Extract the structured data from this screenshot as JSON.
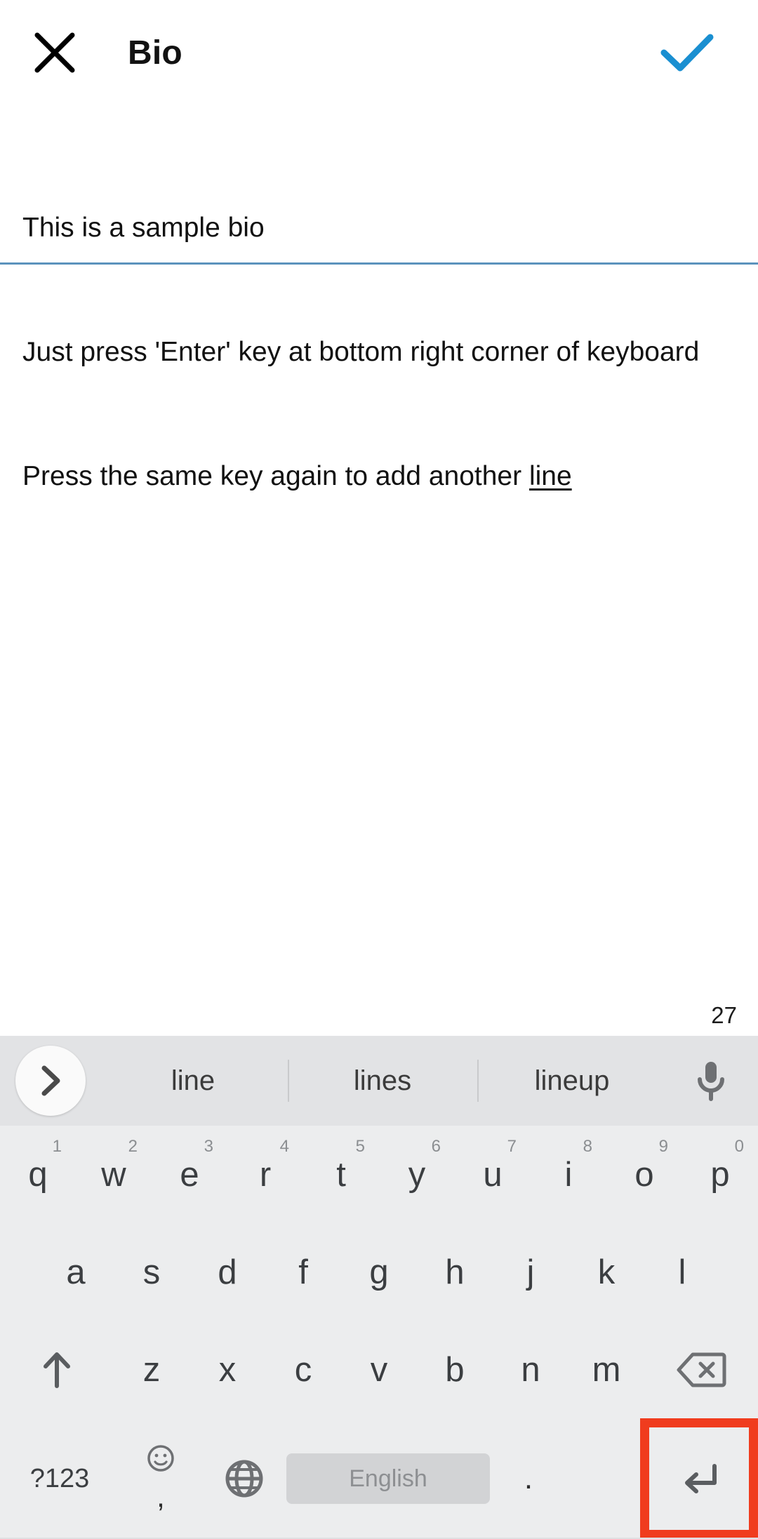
{
  "header": {
    "close_icon": "close-icon",
    "title": "Bio",
    "confirm_icon": "check-icon",
    "accent_color": "#1a8fd1"
  },
  "editor": {
    "lines": [
      "This is a sample bio",
      "Just press 'Enter' key at bottom right corner of keyboard",
      "Press the same key again to add another "
    ],
    "composing_word": "line",
    "char_counter": "27",
    "focus_line_color": "#5b93bd"
  },
  "keyboard": {
    "background": "#ecedee",
    "suggestion_bar": {
      "background": "#e2e3e5",
      "expand_icon": "chevron-right-icon",
      "suggestions": [
        "line",
        "lines",
        "lineup"
      ],
      "mic_icon": "microphone-icon"
    },
    "row1": [
      {
        "letter": "q",
        "num": "1"
      },
      {
        "letter": "w",
        "num": "2"
      },
      {
        "letter": "e",
        "num": "3"
      },
      {
        "letter": "r",
        "num": "4"
      },
      {
        "letter": "t",
        "num": "5"
      },
      {
        "letter": "y",
        "num": "6"
      },
      {
        "letter": "u",
        "num": "7"
      },
      {
        "letter": "i",
        "num": "8"
      },
      {
        "letter": "o",
        "num": "9"
      },
      {
        "letter": "p",
        "num": "0"
      }
    ],
    "row2": [
      "a",
      "s",
      "d",
      "f",
      "g",
      "h",
      "j",
      "k",
      "l"
    ],
    "row3": {
      "shift_icon": "shift-arrow-up-icon",
      "letters": [
        "z",
        "x",
        "c",
        "v",
        "b",
        "n",
        "m"
      ],
      "backspace_icon": "backspace-icon"
    },
    "row4": {
      "symbols_label": "?123",
      "emoji_icon": "emoji-smiley-icon",
      "comma_label": ",",
      "globe_icon": "globe-language-icon",
      "space_label": "English",
      "period_label": ".",
      "enter_icon": "enter-return-icon"
    }
  },
  "annotation": {
    "highlight_color": "#f03c1e",
    "target": "enter-key"
  }
}
